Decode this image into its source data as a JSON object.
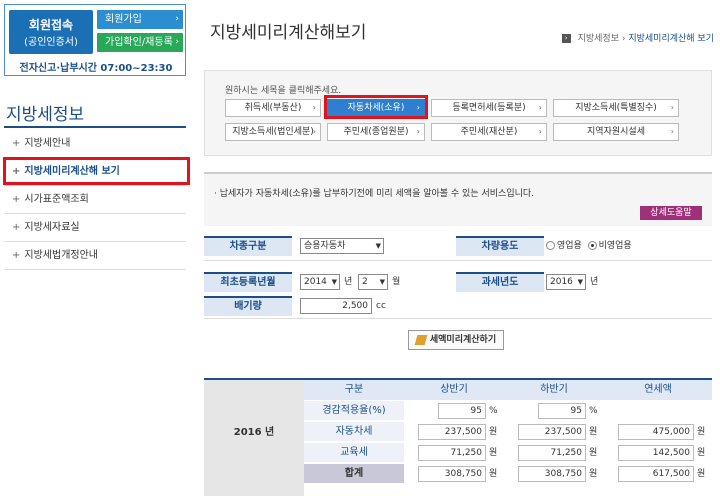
{
  "login": {
    "member_login_line1": "회원접속",
    "member_login_line2": "(공인인증서)",
    "join_label": "회원가입",
    "confirm_label": "가입확인/재등록",
    "hours": "전자신고·납부시간 07:00~23:30"
  },
  "sidebar": {
    "title": "지방세정보",
    "items": [
      {
        "label": "지방세안내"
      },
      {
        "label": "지방세미리계산해 보기"
      },
      {
        "label": "시가표준액조회"
      },
      {
        "label": "지방세자료실"
      },
      {
        "label": "지방세법개정안내"
      }
    ]
  },
  "page": {
    "title": "지방세미리계산해보기",
    "breadcrumb": [
      "지방세정보",
      "지방세미리계산해 보기"
    ]
  },
  "tax_select": {
    "hint": "원하시는 세목을 클릭해주세요.",
    "buttons": [
      {
        "label": "취득세(부동산)"
      },
      {
        "label": "자동차세(소유)"
      },
      {
        "label": "등록면허세(등록분)"
      },
      {
        "label": "지방소득세(특별징수)"
      },
      {
        "label": "지방소득세(법인세분)"
      },
      {
        "label": "주민세(종업원분)"
      },
      {
        "label": "주민세(재산분)"
      },
      {
        "label": "지역자원시설세"
      }
    ],
    "selected_index": 1
  },
  "info": {
    "text": "· 납세자가 자동차세(소유)를 납부하기전에 미리 세액을 알아볼 수 있는 서비스입니다.",
    "help_label": "상세도움말"
  },
  "form": {
    "car_type_label": "차종구분",
    "car_type_value": "승용자동차",
    "usage_label": "차량용도",
    "usage_opt1": "영업용",
    "usage_opt2": "비영업용",
    "usage_selected": "비영업용",
    "reg_date_label": "최초등록년월",
    "reg_year": "2014",
    "reg_year_unit": "년",
    "reg_month": "2",
    "reg_month_unit": "월",
    "tax_year_label": "과세년도",
    "tax_year": "2016",
    "tax_year_unit": "년",
    "displacement_label": "배기량",
    "displacement_value": "2,500",
    "displacement_unit": "cc",
    "calc_label": "세액미리계산하기"
  },
  "result": {
    "year": "2016 년",
    "headers": [
      "구분",
      "상반기",
      "하반기",
      "연세액"
    ],
    "rows": [
      {
        "label": "경감적용율(%)",
        "h1": "95",
        "h1_unit": "%",
        "h2": "95",
        "h2_unit": "%",
        "year": "",
        "year_unit": ""
      },
      {
        "label": "자동차세",
        "h1": "237,500",
        "h1_unit": "원",
        "h2": "237,500",
        "h2_unit": "원",
        "year": "475,000",
        "year_unit": "원"
      },
      {
        "label": "교육세",
        "h1": "71,250",
        "h1_unit": "원",
        "h2": "71,250",
        "h2_unit": "원",
        "year": "142,500",
        "year_unit": "원"
      },
      {
        "label": "합계",
        "h1": "308,750",
        "h1_unit": "원",
        "h2": "308,750",
        "h2_unit": "원",
        "year": "617,500",
        "year_unit": "원"
      }
    ]
  },
  "colors": {
    "primary": "#1a4f8a",
    "highlight": "#e0141c",
    "tab_active": "#2d7fd0",
    "help": "#a0307a"
  }
}
